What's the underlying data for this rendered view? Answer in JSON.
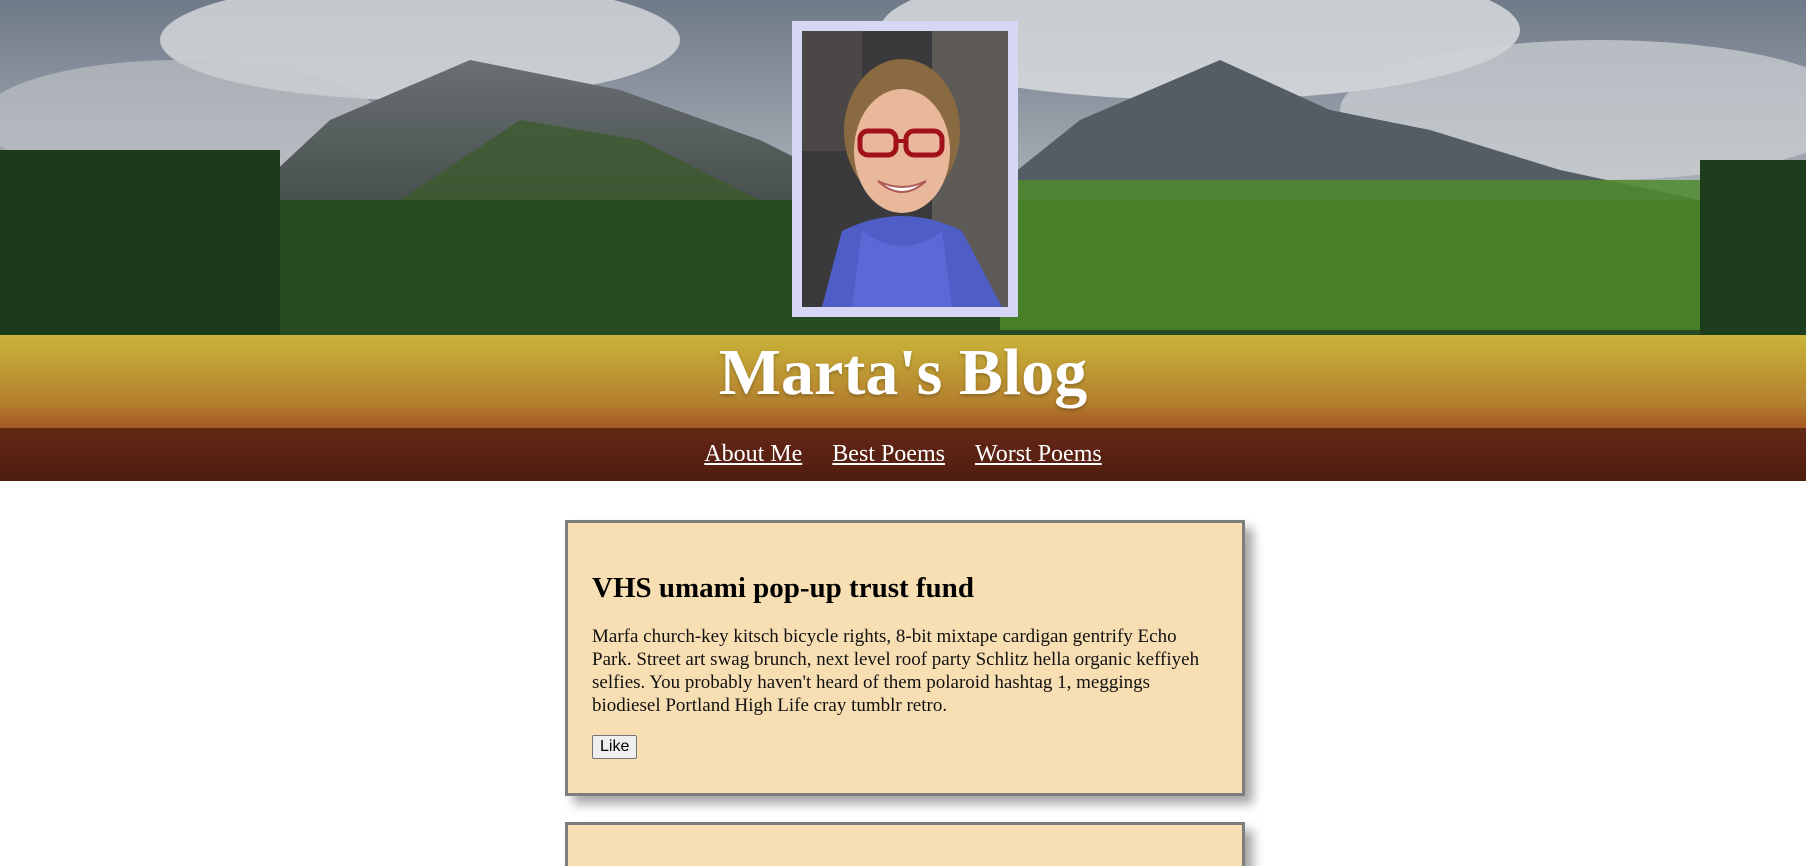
{
  "header": {
    "title": "Marta's Blog",
    "avatar_icon": "profile-photo"
  },
  "nav": {
    "items": [
      {
        "label": "About Me"
      },
      {
        "label": "Best Poems"
      },
      {
        "label": "Worst Poems"
      }
    ]
  },
  "posts": [
    {
      "title": "VHS umami pop-up trust fund",
      "body": "Marfa church-key kitsch bicycle rights, 8-bit mixtape cardigan gentrify Echo Park. Street art swag brunch, next level roof party Schlitz hella organic keffiyeh selfies. You probably haven't heard of them polaroid hashtag 1, meggings biodiesel Portland High Life cray tumblr retro.",
      "like_label": "Like"
    }
  ],
  "colors": {
    "post_background": "#f8dfb3",
    "post_border": "#7e7e7e",
    "nav_background": "#46190f",
    "avatar_frame": "#d6d6f5"
  }
}
